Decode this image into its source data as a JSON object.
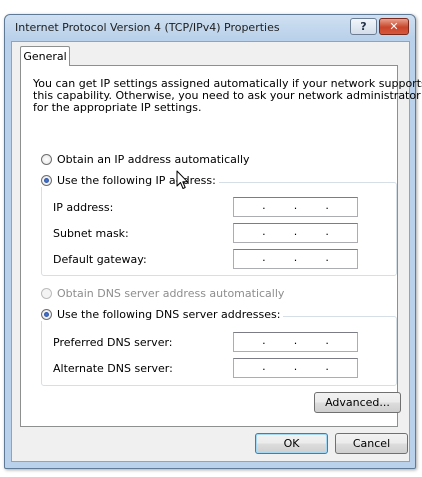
{
  "window": {
    "title": "Internet Protocol Version 4 (TCP/IPv4) Properties",
    "help_label": "?",
    "close_label": "✕"
  },
  "tabs": [
    {
      "label": "General",
      "active": true
    }
  ],
  "intro": {
    "line1": "You can get IP settings assigned automatically if your network supports",
    "line2": "this capability. Otherwise, you need to ask your network administrator",
    "line3": "for the appropriate IP settings."
  },
  "ip": {
    "auto_label": "Obtain an IP address automatically",
    "auto_checked": false,
    "manual_label": "Use the following IP address:",
    "manual_checked": true,
    "fields": [
      {
        "label": "IP address:",
        "value": ""
      },
      {
        "label": "Subnet mask:",
        "value": ""
      },
      {
        "label": "Default gateway:",
        "value": ""
      }
    ]
  },
  "dns": {
    "auto_label": "Obtain DNS server address automatically",
    "auto_checked": false,
    "auto_disabled": true,
    "manual_label": "Use the following DNS server addresses:",
    "manual_checked": true,
    "fields": [
      {
        "label": "Preferred DNS server:",
        "value": ""
      },
      {
        "label": "Alternate DNS server:",
        "value": ""
      }
    ]
  },
  "ip_separator": ".",
  "buttons": {
    "advanced": "Advanced...",
    "ok": "OK",
    "cancel": "Cancel"
  },
  "colors": {
    "titlebar": "#b9d1ea",
    "panel": "#f0f0f0",
    "close_button": "#c8452b"
  },
  "icons": {
    "cursor": "mouse-pointer-icon"
  }
}
